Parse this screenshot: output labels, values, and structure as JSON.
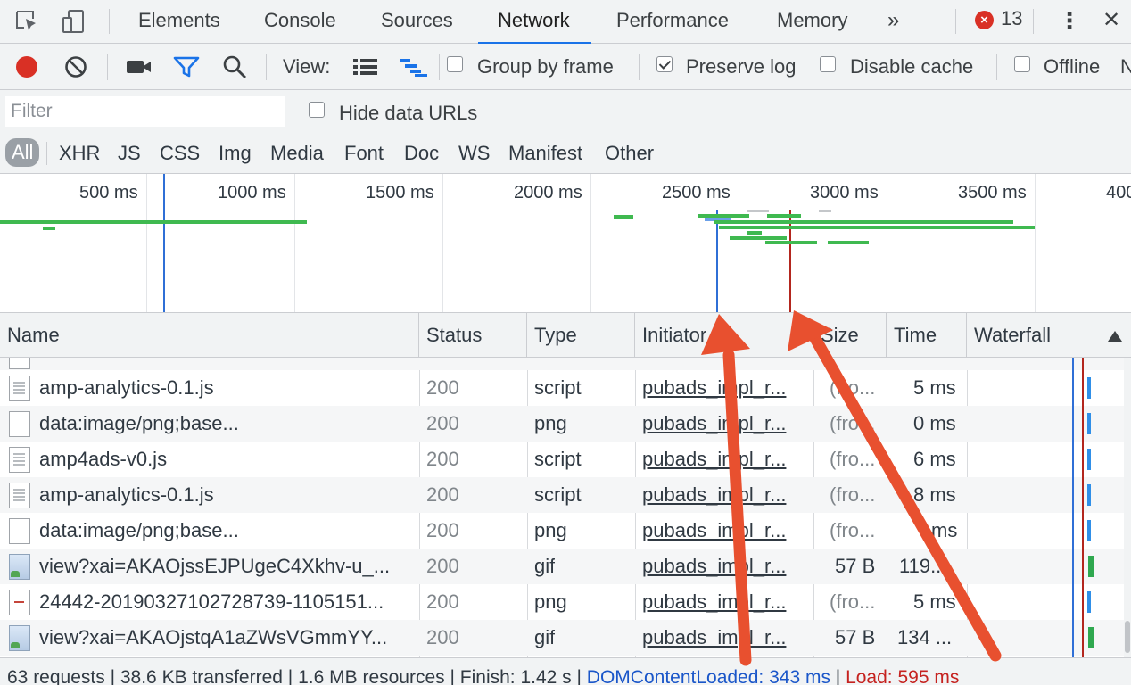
{
  "tabs": {
    "items": [
      "Elements",
      "Console",
      "Sources",
      "Network",
      "Performance",
      "Memory"
    ],
    "active": "Network",
    "more": "»",
    "error_count": "13",
    "menu": "⋮",
    "close": "✕"
  },
  "toolbar": {
    "view_label": "View:",
    "group_by_frame": "Group by frame",
    "group_by_frame_checked": false,
    "preserve_log": "Preserve log",
    "preserve_log_checked": true,
    "disable_cache": "Disable cache",
    "disable_cache_checked": false,
    "offline": "Offline",
    "throttle_cut": "N"
  },
  "filter": {
    "placeholder": "Filter",
    "hide_data_urls": "Hide data URLs"
  },
  "types": [
    "All",
    "XHR",
    "JS",
    "CSS",
    "Img",
    "Media",
    "Font",
    "Doc",
    "WS",
    "Manifest",
    "Other"
  ],
  "overview": {
    "ticks": [
      "500 ms",
      "1000 ms",
      "1500 ms",
      "2000 ms",
      "2500 ms",
      "3000 ms",
      "3500 ms",
      "400"
    ]
  },
  "table": {
    "columns": [
      "Name",
      "Status",
      "Type",
      "Initiator",
      "Size",
      "Time",
      "Waterfall"
    ],
    "sort_column": "Waterfall",
    "rows": [
      {
        "name": "amp-analytics-0.1.js",
        "icon": "script",
        "status": "200",
        "type": "script",
        "initiator": "pubads_impl_r...",
        "size": "(fro...",
        "time": "5 ms"
      },
      {
        "name": "data:image/png;base...",
        "icon": "blank",
        "status": "200",
        "type": "png",
        "initiator": "pubads_impl_r...",
        "size": "(fro...",
        "time": "0 ms"
      },
      {
        "name": "amp4ads-v0.js",
        "icon": "script",
        "status": "200",
        "type": "script",
        "initiator": "pubads_impl_r...",
        "size": "(fro...",
        "time": "6 ms"
      },
      {
        "name": "amp-analytics-0.1.js",
        "icon": "script",
        "status": "200",
        "type": "script",
        "initiator": "pubads_impl_r...",
        "size": "(fro...",
        "time": "8 ms"
      },
      {
        "name": "data:image/png;base...",
        "icon": "blank",
        "status": "200",
        "type": "png",
        "initiator": "pubads_impl_r...",
        "size": "(fro...",
        "time": "ms"
      },
      {
        "name": "view?xai=AKAOjssEJPUgeC4Xkhv-u_...",
        "icon": "image",
        "status": "200",
        "type": "gif",
        "initiator": "pubads_impl_r...",
        "size": "57 B",
        "time": "119..."
      },
      {
        "name": "24442-20190327102728739-1105151...",
        "icon": "redline",
        "status": "200",
        "type": "png",
        "initiator": "pubads_impl_r...",
        "size": "(fro...",
        "time": "5 ms"
      },
      {
        "name": "view?xai=AKAOjstqA1aZWsVGmmYY...",
        "icon": "image",
        "status": "200",
        "type": "gif",
        "initiator": "pubads_impl_r...",
        "size": "57 B",
        "time": "134 ..."
      }
    ]
  },
  "status": {
    "summary": "63 requests | 38.6 KB transferred | 1.6 MB resources | Finish: 1.42 s | ",
    "dom_content_loaded": "DOMContentLoaded: 343 ms",
    "divider": " | ",
    "load": "Load: 595 ms"
  },
  "colors": {
    "accent": "#1a73e8",
    "record": "#d93025",
    "dom_line": "#2f6fd6",
    "load_line": "#b3261e",
    "bar_green": "#3fb950",
    "arrow": "#e8502f"
  }
}
